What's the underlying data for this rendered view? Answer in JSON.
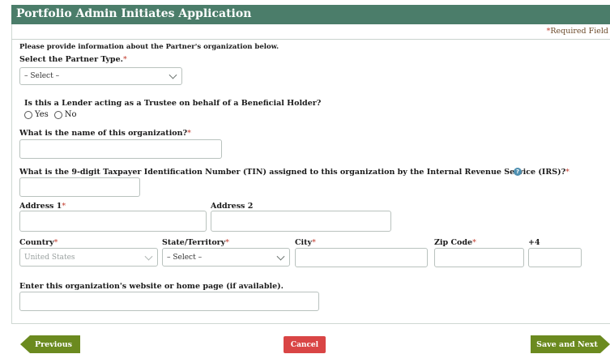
{
  "header": {
    "title": "Portfolio Admin Initiates Application"
  },
  "required_note": {
    "star": "*",
    "text": "Required Field"
  },
  "intro": "Please provide information about the Partner's organization below.",
  "partner_type": {
    "label": "Select the Partner Type.",
    "star": "*",
    "value": "– Select –"
  },
  "trustee_question": {
    "label": "Is this a Lender acting as a Trustee on behalf of a Beneficial Holder?",
    "yes": "Yes",
    "no": "No"
  },
  "org_name": {
    "label": "What is the name of this organization?",
    "star": "*"
  },
  "tin": {
    "label": "What is the 9-digit Taxpayer Identification Number (TIN) assigned to this organization by the Internal Revenue Service (IRS)?",
    "star": "*",
    "help_icon": "?"
  },
  "address1": {
    "label": "Address 1",
    "star": "*"
  },
  "address2": {
    "label": "Address 2"
  },
  "country": {
    "label": "Country",
    "star": "*",
    "value": "United States"
  },
  "state": {
    "label": "State/Territory",
    "star": "*",
    "value": "– Select –"
  },
  "city": {
    "label": "City",
    "star": "*"
  },
  "zip": {
    "label": "Zip Code",
    "star": "*"
  },
  "plus4": {
    "label": "+4"
  },
  "website": {
    "label": "Enter this organization's website or home page (if available)."
  },
  "buttons": {
    "previous": "Previous",
    "cancel": "Cancel",
    "next": "Save and Next"
  },
  "colors": {
    "header": "#4b7d6a",
    "nav_button": "#6b8a1f",
    "cancel_button": "#d94545",
    "required": "#c0392b"
  }
}
